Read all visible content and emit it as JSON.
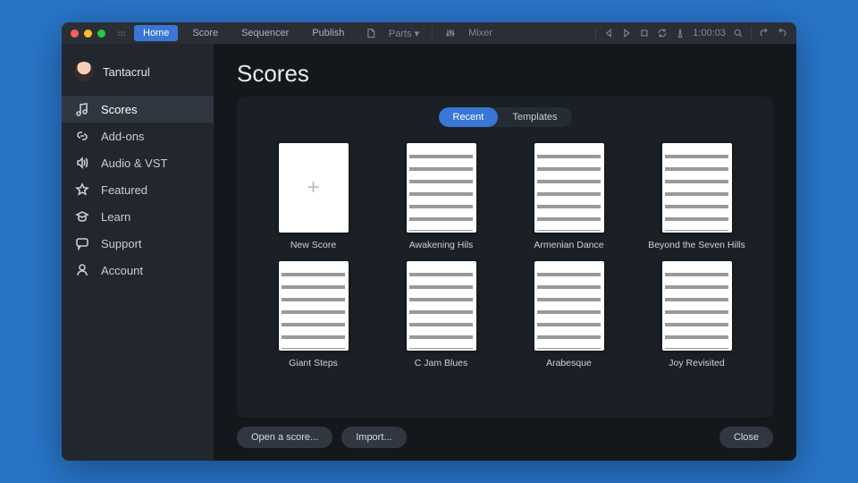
{
  "window": {
    "traffic": true
  },
  "topnav": {
    "tabs": [
      {
        "label": "Home",
        "active": true
      },
      {
        "label": "Score",
        "active": false
      },
      {
        "label": "Sequencer",
        "active": false
      },
      {
        "label": "Publish",
        "active": false
      }
    ],
    "center": {
      "parts_label": "Parts",
      "mixer_label": "Mixer"
    },
    "right": {
      "timecode": "1:00:03"
    }
  },
  "sidebar": {
    "user": "Tantacrul",
    "items": [
      {
        "id": "scores",
        "label": "Scores",
        "icon": "music",
        "active": true
      },
      {
        "id": "addons",
        "label": "Add-ons",
        "icon": "link",
        "active": false
      },
      {
        "id": "audio",
        "label": "Audio & VST",
        "icon": "speaker",
        "active": false
      },
      {
        "id": "featured",
        "label": "Featured",
        "icon": "star",
        "active": false
      },
      {
        "id": "learn",
        "label": "Learn",
        "icon": "cap",
        "active": false
      },
      {
        "id": "support",
        "label": "Support",
        "icon": "chat",
        "active": false
      },
      {
        "id": "account",
        "label": "Account",
        "icon": "user",
        "active": false
      }
    ]
  },
  "page": {
    "title": "Scores",
    "tabs": {
      "recent": "Recent",
      "templates": "Templates",
      "selected": "recent"
    },
    "scores": [
      {
        "label": "New Score",
        "is_new": true
      },
      {
        "label": "Awakening Hils"
      },
      {
        "label": "Armenian Dance"
      },
      {
        "label": "Beyond the Seven Hills"
      },
      {
        "label": "Giant Steps"
      },
      {
        "label": "C Jam Blues"
      },
      {
        "label": "Arabesque"
      },
      {
        "label": "Joy Revisited"
      }
    ],
    "footer": {
      "open": "Open a score...",
      "import": "Import...",
      "close": "Close"
    }
  }
}
